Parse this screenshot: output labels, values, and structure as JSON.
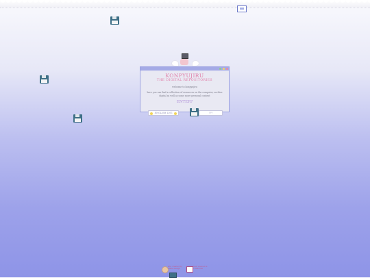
{
  "window": {
    "title": "KONPYUJIRU",
    "subtitle": "THE DIGITAL REPOSITORIES",
    "welcome": "welcome to konpyujiru",
    "description": "here you can find a collection of resources on the computer, archive digital as well as some more personal content",
    "enter": "ENTER?"
  },
  "buttons": {
    "left_label": "ENGLISH LNG",
    "right_label": "???"
  },
  "footer": {
    "left_text": "site created by mana design",
    "right_text": "best viewed in 1024x768"
  },
  "colors": {
    "accent": "#e07aa5",
    "titlebar": "#a4aae6",
    "floppy": "#3e6f86"
  },
  "icons": [
    "floppy-disk-icon",
    "computer-mascot-icon",
    "wing-icon",
    "window-icon"
  ]
}
